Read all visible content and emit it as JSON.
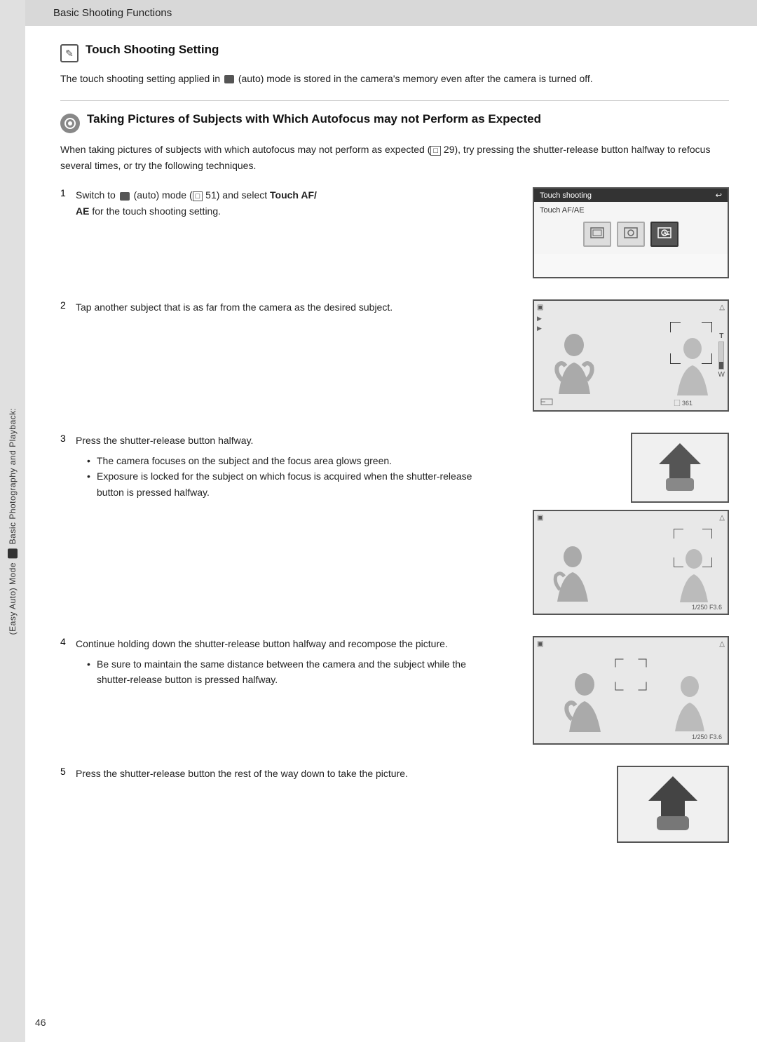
{
  "header": {
    "title": "Basic Shooting Functions"
  },
  "page_number": "46",
  "sidebar": {
    "label": "Basic Photography and Playback:",
    "mode_label": "(Easy Auto) Mode"
  },
  "touch_section": {
    "icon_symbol": "✎",
    "title": "Touch Shooting Setting",
    "body": "The touch shooting setting applied in  (auto) mode is stored in the camera's memory even after the camera is turned off."
  },
  "autofocus_section": {
    "title": "Taking Pictures of Subjects with Which Autofocus may not Perform as Expected",
    "intro": "When taking pictures of subjects with which autofocus may not perform as expected (  29), try pressing the shutter-release button halfway to refocus several times, or try the following techniques."
  },
  "steps": [
    {
      "number": "1",
      "text": "Switch to  (auto) mode (  51) and select Touch AF/AE for the touch shooting setting.",
      "bold_part": "Touch AF/AE"
    },
    {
      "number": "2",
      "text": "Tap another subject that is as far from the camera as the desired subject."
    },
    {
      "number": "3",
      "text": "Press the shutter-release button halfway.",
      "bullets": [
        "The camera focuses on the subject and the focus area glows green.",
        "Exposure is locked for the subject on which focus is acquired when the shutter-release button is pressed halfway."
      ]
    },
    {
      "number": "4",
      "text": "Continue holding down the shutter-release button halfway and recompose the picture.",
      "bullets": [
        "Be sure to maintain the same distance between the camera and the subject while the shutter-release button is pressed halfway."
      ]
    },
    {
      "number": "5",
      "text": "Press the shutter-release button the rest of the way down to take the picture."
    }
  ],
  "screen_labels": {
    "touch_shooting": "Touch shooting",
    "touch_afae": "Touch AF/AE",
    "shutter_info1": "1/250  F3.6",
    "shutter_info2": "1/250  F3.6"
  }
}
